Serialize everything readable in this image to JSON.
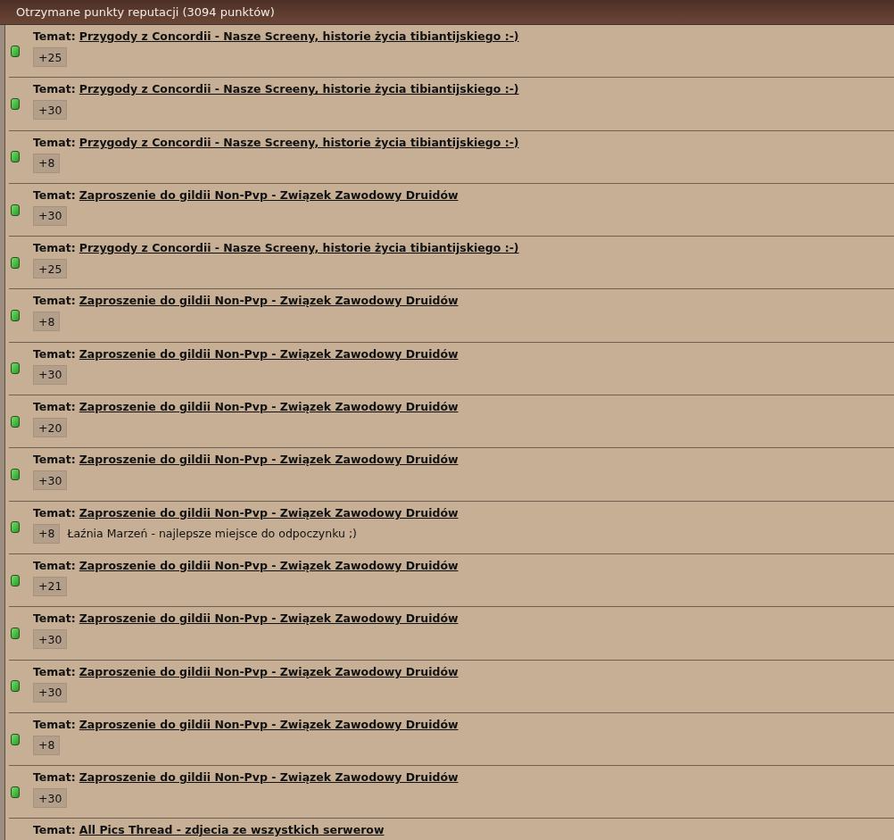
{
  "header": {
    "title": "Otrzymane punkty reputacji (3094 punktów)"
  },
  "entries": [
    {
      "label": "Temat:",
      "topic": "Przygody z Concordii - Nasze Screeny, historie życia tibiantijskiego :-)",
      "points": "+25"
    },
    {
      "label": "Temat:",
      "topic": "Przygody z Concordii - Nasze Screeny, historie życia tibiantijskiego :-)",
      "points": "+30"
    },
    {
      "label": "Temat:",
      "topic": "Przygody z Concordii - Nasze Screeny, historie życia tibiantijskiego :-)",
      "points": "+8"
    },
    {
      "label": "Temat:",
      "topic": "Zaproszenie do gildii Non-Pvp - Związek Zawodowy Druidów",
      "points": "+30"
    },
    {
      "label": "Temat:",
      "topic": "Przygody z Concordii - Nasze Screeny, historie życia tibiantijskiego :-)",
      "points": "+25"
    },
    {
      "label": "Temat:",
      "topic": "Zaproszenie do gildii Non-Pvp - Związek Zawodowy Druidów",
      "points": "+8"
    },
    {
      "label": "Temat:",
      "topic": "Zaproszenie do gildii Non-Pvp - Związek Zawodowy Druidów",
      "points": "+30"
    },
    {
      "label": "Temat:",
      "topic": "Zaproszenie do gildii Non-Pvp - Związek Zawodowy Druidów",
      "points": "+20"
    },
    {
      "label": "Temat:",
      "topic": "Zaproszenie do gildii Non-Pvp - Związek Zawodowy Druidów",
      "points": "+30"
    },
    {
      "label": "Temat:",
      "topic": "Zaproszenie do gildii Non-Pvp - Związek Zawodowy Druidów",
      "points": "+8",
      "comment": "Łaźnia Marzeń - najlepsze miejsce do odpoczynku ;)"
    },
    {
      "label": "Temat:",
      "topic": "Zaproszenie do gildii Non-Pvp - Związek Zawodowy Druidów",
      "points": "+21"
    },
    {
      "label": "Temat:",
      "topic": "Zaproszenie do gildii Non-Pvp - Związek Zawodowy Druidów",
      "points": "+30"
    },
    {
      "label": "Temat:",
      "topic": "Zaproszenie do gildii Non-Pvp - Związek Zawodowy Druidów",
      "points": "+30"
    },
    {
      "label": "Temat:",
      "topic": "Zaproszenie do gildii Non-Pvp - Związek Zawodowy Druidów",
      "points": "+8"
    },
    {
      "label": "Temat:",
      "topic": "Zaproszenie do gildii Non-Pvp - Związek Zawodowy Druidów",
      "points": "+30"
    },
    {
      "label": "Temat:",
      "topic": "All Pics Thread - zdjecia ze wszystkich serwerow"
    }
  ]
}
